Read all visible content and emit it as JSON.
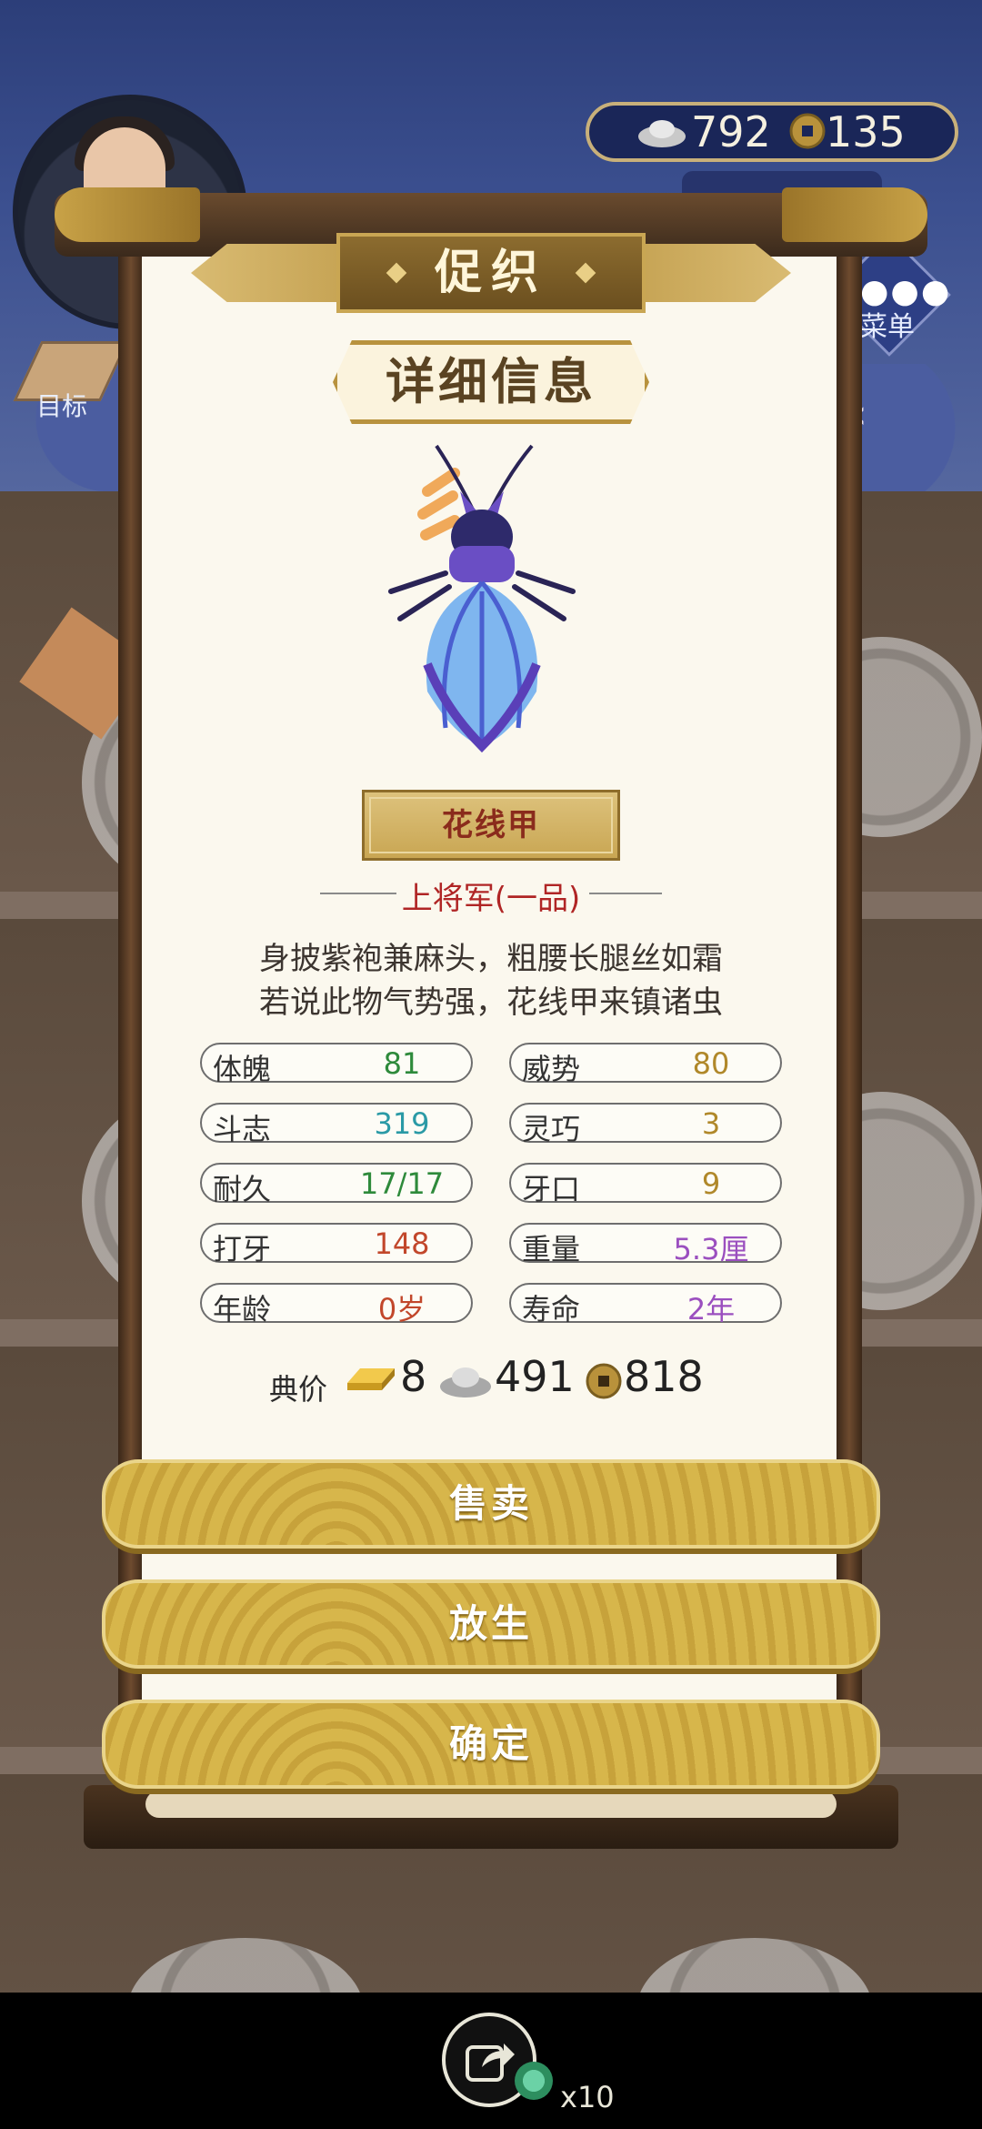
{
  "header": {
    "currency": {
      "silver": "792",
      "coin": "135"
    },
    "target_label": "目标",
    "menu_label": "菜单"
  },
  "panel": {
    "title": "促织",
    "section": "详细信息",
    "insect_name": "花线甲",
    "rank": "上将军(一品)",
    "poem": [
      "身披紫袍兼麻头，粗腰长腿丝如霜",
      "若说此物气势强，花线甲来镇诸虫"
    ],
    "stats": [
      {
        "label": "体魄",
        "value": "81",
        "color": "#2e8a3b"
      },
      {
        "label": "威势",
        "value": "80",
        "color": "#b0882a"
      },
      {
        "label": "斗志",
        "value": "319",
        "color": "#2a9aa6"
      },
      {
        "label": "灵巧",
        "value": "3",
        "color": "#b0882a"
      },
      {
        "label": "耐久",
        "value": "17/17",
        "color": "#2e8a3b"
      },
      {
        "label": "牙口",
        "value": "9",
        "color": "#b0882a"
      },
      {
        "label": "打牙",
        "value": "148",
        "color": "#c2472b"
      },
      {
        "label": "重量",
        "value": "5.3厘",
        "color": "#9b4fbf"
      },
      {
        "label": "年龄",
        "value": "0岁",
        "color": "#c2472b"
      },
      {
        "label": "寿命",
        "value": "2年",
        "color": "#9b4fbf"
      }
    ],
    "price": {
      "label": "典价",
      "gold": "8",
      "silver": "491",
      "coin": "818"
    },
    "actions": {
      "sell": "售卖",
      "release": "放生",
      "confirm": "确定"
    }
  },
  "footer": {
    "share_count": "x10"
  },
  "icons": [
    "silver-ingot-icon",
    "copper-coin-icon",
    "gold-bar-icon",
    "target-scroll-icon",
    "menu-dots-icon",
    "share-icon",
    "jade-gem-icon",
    "chevron-left-icon"
  ]
}
